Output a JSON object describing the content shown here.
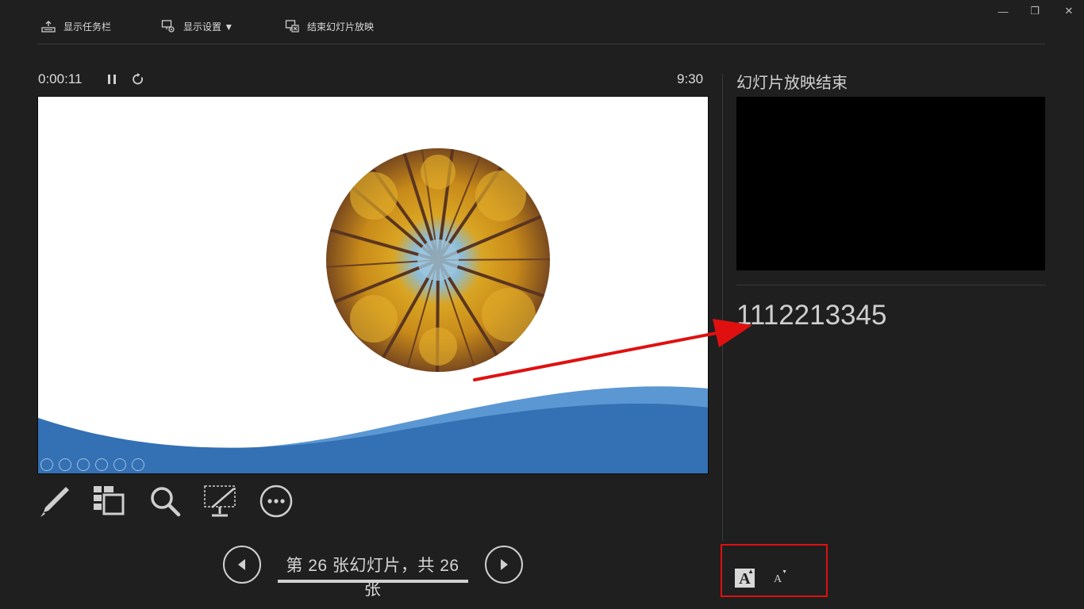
{
  "window_controls": {
    "minimize": "—",
    "restore": "❐",
    "close": "✕"
  },
  "toolbar": {
    "show_taskbar": "显示任务栏",
    "display_settings": "显示设置 ▼",
    "end_slideshow": "结束幻灯片放映"
  },
  "timer": {
    "elapsed": "0:00:11",
    "clock": "9:30"
  },
  "navigation": {
    "slide_count": "第 26 张幻灯片，共 26 张"
  },
  "next_slide": {
    "title": "幻灯片放映结束"
  },
  "notes": {
    "text": "1112213345"
  },
  "font_controls": {
    "increase": "A",
    "decrease": "A"
  },
  "colors": {
    "background": "#1f1f1f",
    "wave_primary": "#3470b4",
    "wave_light": "#5b97d3",
    "annotation_red": "#e01010"
  },
  "icons": [
    "taskbar-icon",
    "display-settings-icon",
    "end-show-icon",
    "pause-icon",
    "restart-icon",
    "pen-icon",
    "see-all-slides-icon",
    "zoom-icon",
    "black-screen-icon",
    "more-options-icon",
    "previous-icon",
    "next-icon"
  ]
}
